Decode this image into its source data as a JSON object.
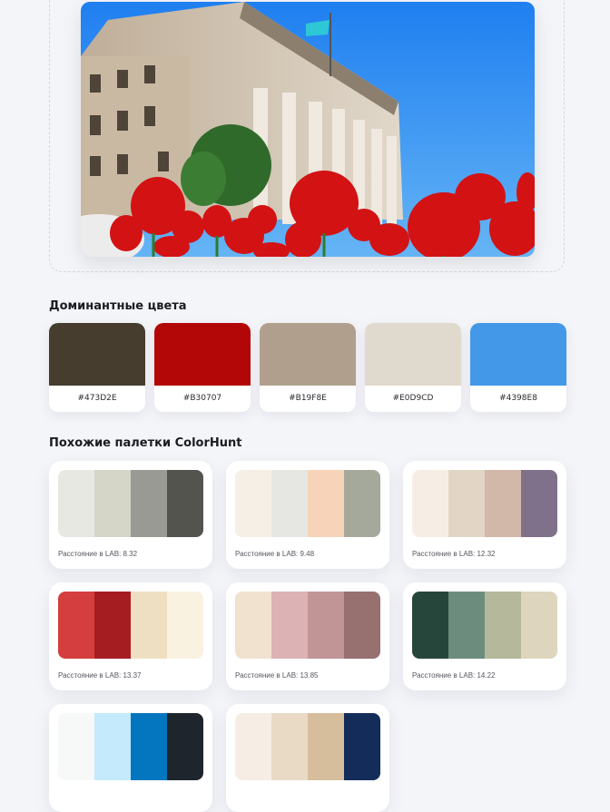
{
  "dominant_section": {
    "title": "Доминантные цвета",
    "swatches": [
      {
        "hex": "#473D2E",
        "color": "#473D2E"
      },
      {
        "hex": "#B30707",
        "color": "#B30707"
      },
      {
        "hex": "#B19F8E",
        "color": "#B19F8E"
      },
      {
        "hex": "#E0D9CD",
        "color": "#E0D9CD"
      },
      {
        "hex": "#4398E8",
        "color": "#4398E8"
      }
    ]
  },
  "similar_section": {
    "title": "Похожие палетки ColorHunt",
    "palettes": [
      {
        "distance": "Расстояние в LAB: 8.32",
        "colors": [
          "#E8E8E3",
          "#D5D6C8",
          "#9A9A95",
          "#54544F"
        ]
      },
      {
        "distance": "Расстояние в LAB: 9.48",
        "colors": [
          "#F5EFE5",
          "#E6E6E3",
          "#F7D3B9",
          "#A5A99C"
        ]
      },
      {
        "distance": "Расстояние в LAB: 12.32",
        "colors": [
          "#F6EEE4",
          "#E2D5C5",
          "#D2B8A9",
          "#80718A"
        ]
      },
      {
        "distance": "Расстояние в LAB: 13.37",
        "colors": [
          "#D53E3E",
          "#A51D20",
          "#EEDFC3",
          "#F9F2E0"
        ]
      },
      {
        "distance": "Расстояние в LAB: 13.85",
        "colors": [
          "#F1E2CF",
          "#DCB2B4",
          "#C19596",
          "#977070"
        ]
      },
      {
        "distance": "Расстояние в LAB: 14.22",
        "colors": [
          "#27463B",
          "#6C8D7E",
          "#B5B89A",
          "#DDD5BE"
        ]
      },
      {
        "distance": "",
        "colors": [
          "#F7F8F8",
          "#C4EAFB",
          "#0476BF",
          "#1E252C"
        ]
      },
      {
        "distance": "",
        "colors": [
          "#F6EEE4",
          "#E8DAC5",
          "#D6BD9C",
          "#132C5A"
        ]
      }
    ]
  }
}
